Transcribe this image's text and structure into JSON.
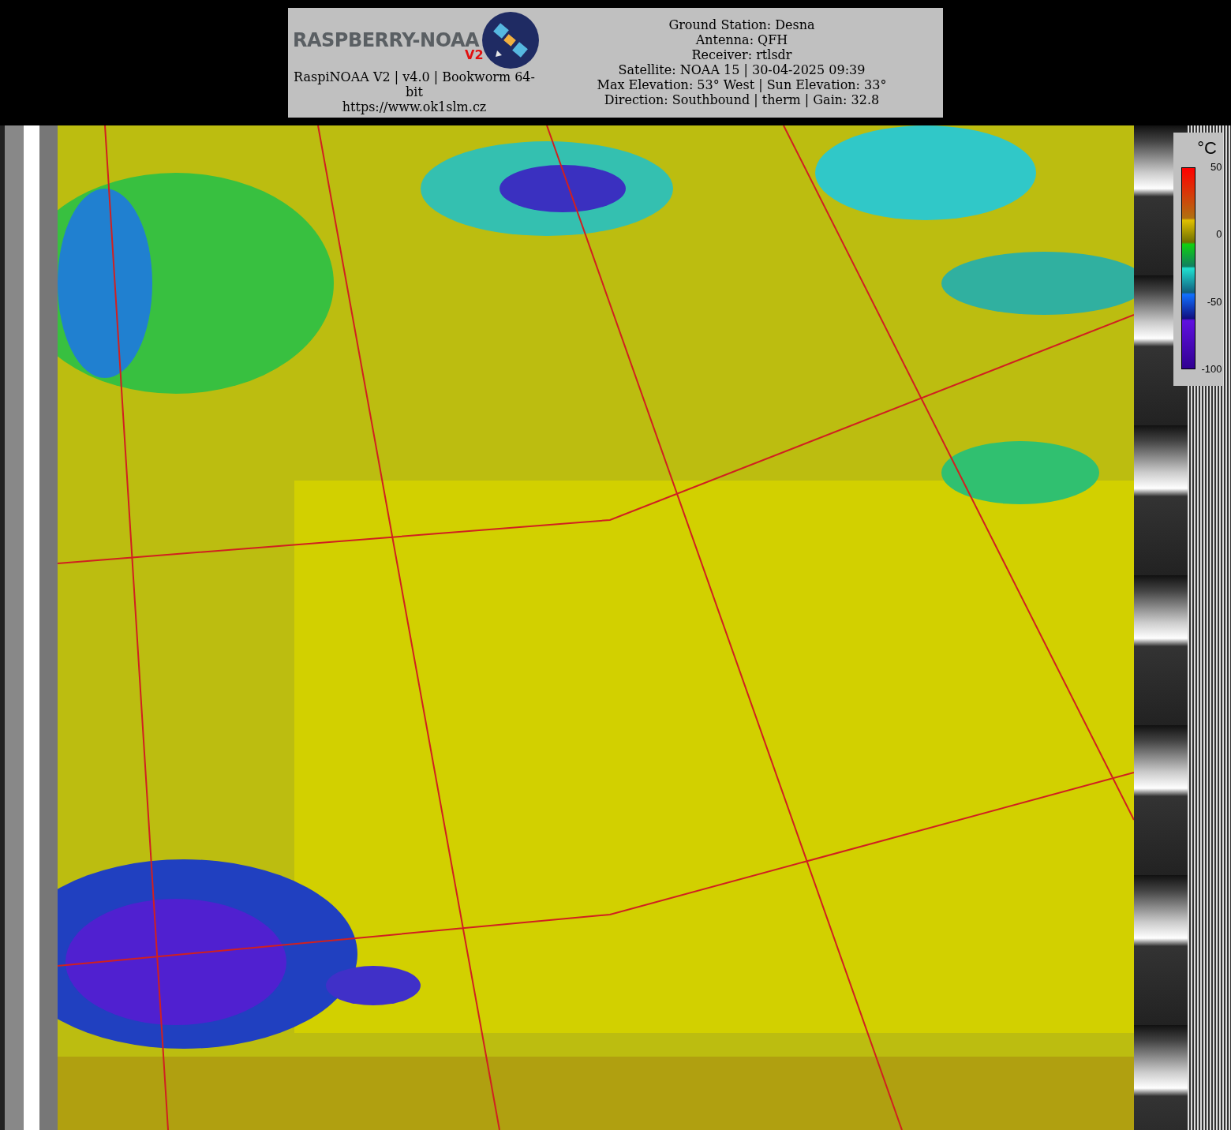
{
  "header": {
    "logo": {
      "text": "RASPBERRY-NOAA",
      "badge": "V2"
    },
    "info_lines": [
      "RaspiNOAA V2 | v4.0 | Bookworm 64-bit",
      "https://www.ok1slm.cz"
    ],
    "station_lines": [
      "Ground Station: Desna",
      "Antenna: QFH",
      "Receiver: rtlsdr",
      "Satellite: NOAA 15 | 30-04-2025 09:39",
      "Max Elevation: 53° West | Sun Elevation: 33°",
      "Direction: Southbound | therm | Gain: 32.8"
    ]
  },
  "legend": {
    "unit": "°C",
    "ticks": [
      "50",
      "0",
      "-50",
      "-100"
    ]
  }
}
